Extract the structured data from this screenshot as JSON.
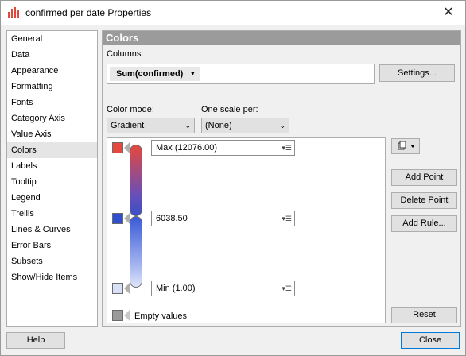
{
  "window": {
    "title": "confirmed per date Properties",
    "close_glyph": "✕"
  },
  "nav": {
    "items": [
      "General",
      "Data",
      "Appearance",
      "Formatting",
      "Fonts",
      "Category Axis",
      "Value Axis",
      "Colors",
      "Labels",
      "Tooltip",
      "Legend",
      "Trellis",
      "Lines & Curves",
      "Error Bars",
      "Subsets",
      "Show/Hide Items"
    ],
    "selected": "Colors"
  },
  "panel": {
    "title": "Colors",
    "columns_label": "Columns:",
    "column_chip": "Sum(confirmed)",
    "settings_button": "Settings...",
    "color_mode_label": "Color mode:",
    "color_mode_value": "Gradient",
    "one_scale_label": "One scale per:",
    "one_scale_value": "(None)",
    "points": [
      {
        "label": "Max (12076.00)",
        "color": "#e5483e"
      },
      {
        "label": "6038.50",
        "color": "#2f4fd0"
      },
      {
        "label": "Min (1.00)",
        "color": "#d7e0f7"
      }
    ],
    "empty_values_label": "Empty values",
    "empty_color": "#9a9a9a",
    "add_point": "Add Point",
    "delete_point": "Delete Point",
    "add_rule": "Add Rule...",
    "reset": "Reset"
  },
  "footer": {
    "help": "Help",
    "close": "Close"
  },
  "icons": {
    "app": "bar-chart-icon",
    "close": "close-icon",
    "copy": "copy-icon",
    "dropdown": "chevron-down-icon"
  }
}
